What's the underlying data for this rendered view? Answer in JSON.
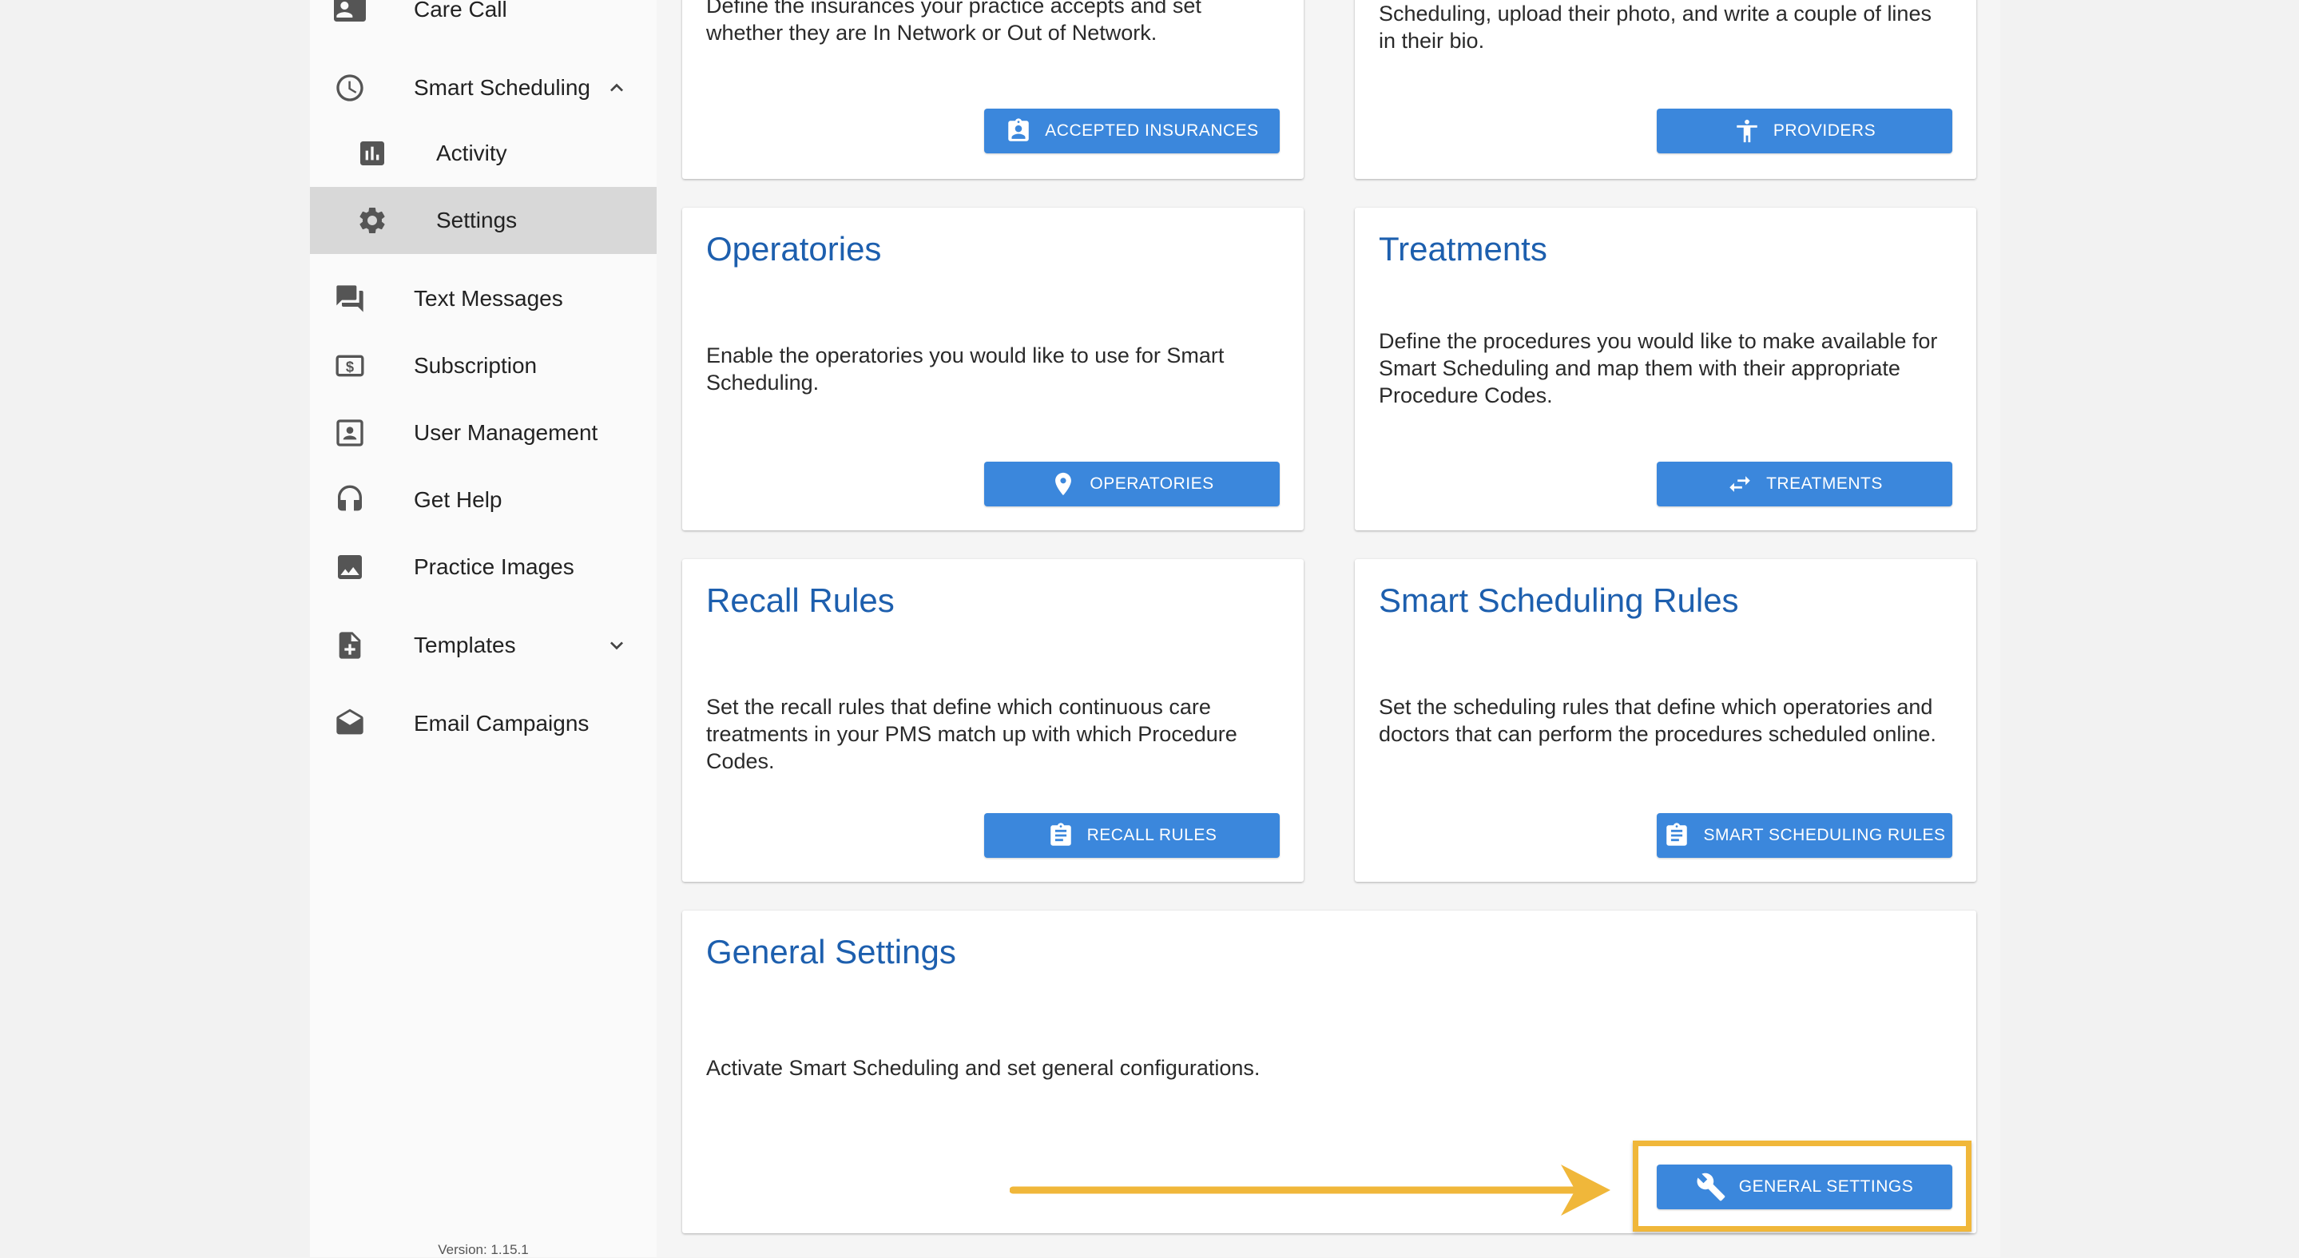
{
  "sidebar": {
    "items": [
      {
        "label": "Care Call",
        "icon": "contact-phone-icon"
      },
      {
        "label": "Smart Scheduling",
        "icon": "clock-icon",
        "expanded": true
      },
      {
        "label": "Activity",
        "icon": "bar-chart-icon",
        "sub": true
      },
      {
        "label": "Settings",
        "icon": "gear-icon",
        "sub": true,
        "active": true
      },
      {
        "label": "Text Messages",
        "icon": "chat-icon"
      },
      {
        "label": "Subscription",
        "icon": "dollar-icon"
      },
      {
        "label": "User Management",
        "icon": "user-card-icon"
      },
      {
        "label": "Get Help",
        "icon": "headset-icon"
      },
      {
        "label": "Practice Images",
        "icon": "image-icon"
      },
      {
        "label": "Templates",
        "icon": "add-document-icon",
        "expanded": false
      },
      {
        "label": "Email Campaigns",
        "icon": "open-mail-icon"
      }
    ],
    "version": "Version: 1.15.1"
  },
  "cards": {
    "insurances": {
      "desc": "Define the insurances your practice accepts and set whether they are In Network or Out of Network.",
      "button": "ACCEPTED INSURANCES"
    },
    "providers": {
      "desc": "Scheduling, upload their photo, and write a couple of lines in their bio.",
      "button": "PROVIDERS"
    },
    "operatories": {
      "title": "Operatories",
      "desc": "Enable the operatories you would like to use for Smart Scheduling.",
      "button": "OPERATORIES"
    },
    "treatments": {
      "title": "Treatments",
      "desc": "Define the procedures you would like to make available for Smart Scheduling and map them with their appropriate Procedure Codes.",
      "button": "TREATMENTS"
    },
    "recall": {
      "title": "Recall Rules",
      "desc": "Set the recall rules that define which continuous care treatments in your PMS match up with which Procedure Codes.",
      "button": "RECALL RULES"
    },
    "ss_rules": {
      "title": "Smart Scheduling Rules",
      "desc": "Set the scheduling rules that define which operatories and doctors that can perform the procedures scheduled online.",
      "button": "SMART SCHEDULING RULES"
    },
    "general": {
      "title": "General Settings",
      "desc": "Activate Smart Scheduling and set general configurations.",
      "button": "GENERAL SETTINGS"
    }
  },
  "colors": {
    "accent": "#3b87dc",
    "title": "#1d5fae",
    "highlight": "#f0b73a"
  }
}
